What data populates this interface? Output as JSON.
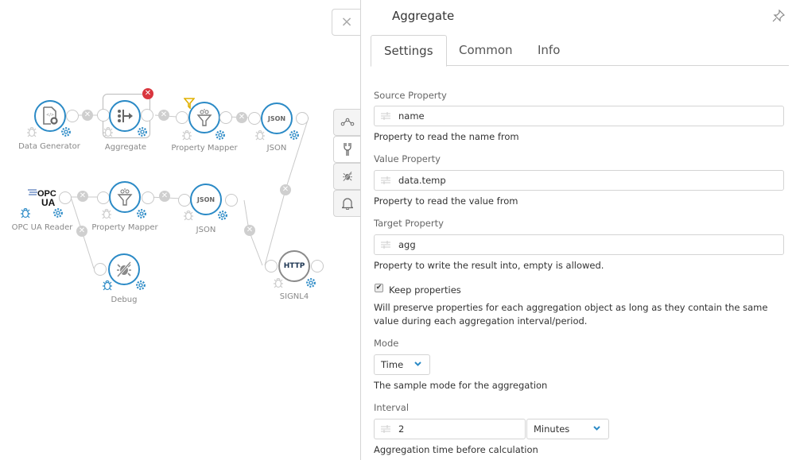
{
  "canvas": {
    "nodes": [
      {
        "id": "data-generator",
        "label": "Data Generator",
        "icon": "file-gear-icon"
      },
      {
        "id": "aggregate",
        "label": "Aggregate",
        "icon": "aggregate-icon",
        "selected": true
      },
      {
        "id": "property-mapper-1",
        "label": "Property Mapper",
        "icon": "funnel-icon",
        "filter": true
      },
      {
        "id": "json-1",
        "label": "JSON",
        "icon_text": "JSON"
      },
      {
        "id": "opc-ua-reader",
        "label": "OPC UA Reader",
        "icon_text": "OPC UA"
      },
      {
        "id": "property-mapper-2",
        "label": "Property Mapper",
        "icon": "funnel-icon"
      },
      {
        "id": "json-2",
        "label": "JSON",
        "icon_text": "JSON"
      },
      {
        "id": "debug",
        "label": "Debug",
        "icon": "debug-off-icon"
      },
      {
        "id": "signl4",
        "label": "SIGNL4",
        "icon_text": "HTTP"
      }
    ]
  },
  "sidebar": {
    "close_label": "×",
    "tools": [
      {
        "name": "flow-icon"
      },
      {
        "name": "plug-icon",
        "active": true
      },
      {
        "name": "debug-off-icon"
      },
      {
        "name": "bell-icon"
      }
    ]
  },
  "panel": {
    "title": "Aggregate",
    "tabs": [
      {
        "label": "Settings",
        "active": true
      },
      {
        "label": "Common"
      },
      {
        "label": "Info"
      }
    ],
    "fields": {
      "source": {
        "label": "Source Property",
        "value": "name",
        "help": "Property to read the name from"
      },
      "value": {
        "label": "Value Property",
        "value": "data.temp",
        "help": "Property to read the value from"
      },
      "target": {
        "label": "Target Property",
        "value": "agg",
        "help": "Property to write the result into, empty is allowed."
      },
      "keep": {
        "label": "Keep properties",
        "checked": true,
        "help_line1": "Will preserve properties for each aggregation object as long as they contain the same",
        "help_line2": "value during each aggregation interval/period."
      },
      "mode": {
        "label": "Mode",
        "value": "Time",
        "help": "The sample mode for the aggregation"
      },
      "interval": {
        "label": "Interval",
        "value": "2",
        "unit": "Minutes",
        "help": "Aggregation time before calculation"
      }
    }
  },
  "colors": {
    "accent": "#2b8ac6",
    "delete": "#d9363e",
    "filter": "#e0b000"
  }
}
